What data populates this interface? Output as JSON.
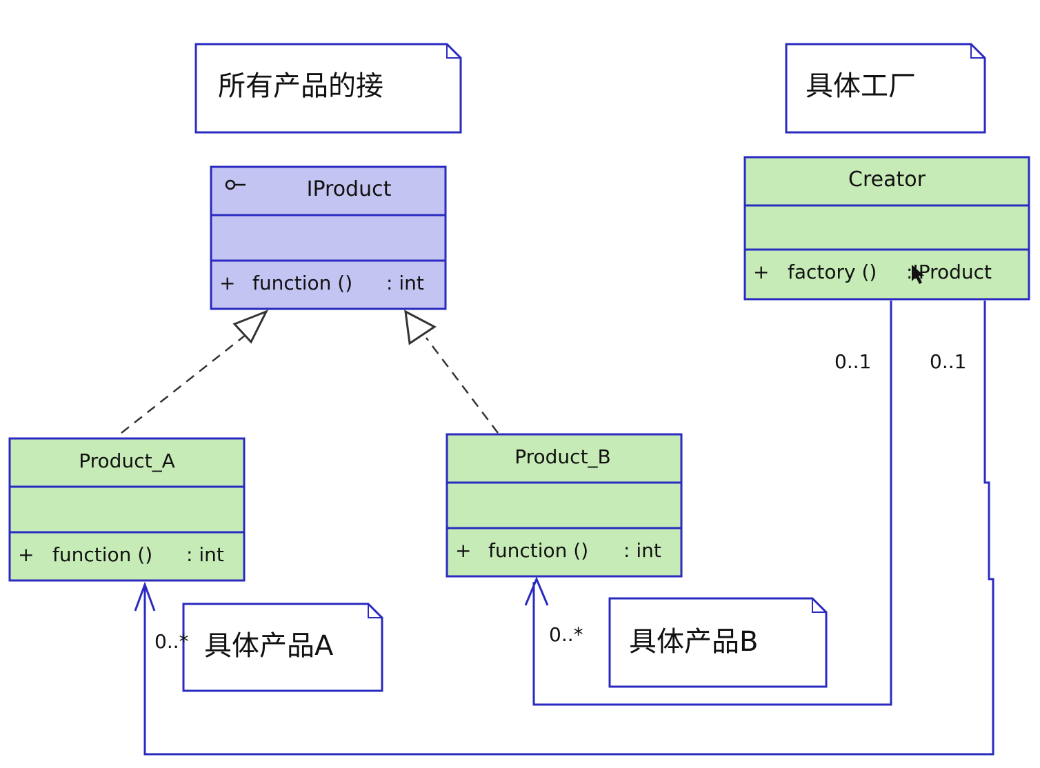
{
  "notes": {
    "iproduct": "所有产品的接",
    "factory": "具体工厂",
    "product_a": "具体产品A",
    "product_b": "具体产品B"
  },
  "classes": {
    "iproduct": {
      "name": "IProduct",
      "visibility": "+",
      "operation": "function ()",
      "type": ": int",
      "fill": "#c4c4f2"
    },
    "creator": {
      "name": "Creator",
      "visibility": "+",
      "operation": "factory ()",
      "type": ":IProduct",
      "fill": "#c6ebb6"
    },
    "product_a": {
      "name": "Product_A",
      "visibility": "+",
      "operation": "function ()",
      "type": ": int",
      "fill": "#c6ebb6"
    },
    "product_b": {
      "name": "Product_B",
      "visibility": "+",
      "operation": "function ()",
      "type": ": int",
      "fill": "#c6ebb6"
    }
  },
  "multiplicities": {
    "creator_left": "0..1",
    "creator_right": "0..1",
    "product_a": "0..*",
    "product_b": "0..*"
  },
  "colors": {
    "border": "#2a2ac0",
    "line": "#2a2ac0",
    "dashed": "#333333"
  },
  "icons": {
    "interface": "lollipop-icon",
    "cursor": "arrow-cursor-icon"
  }
}
